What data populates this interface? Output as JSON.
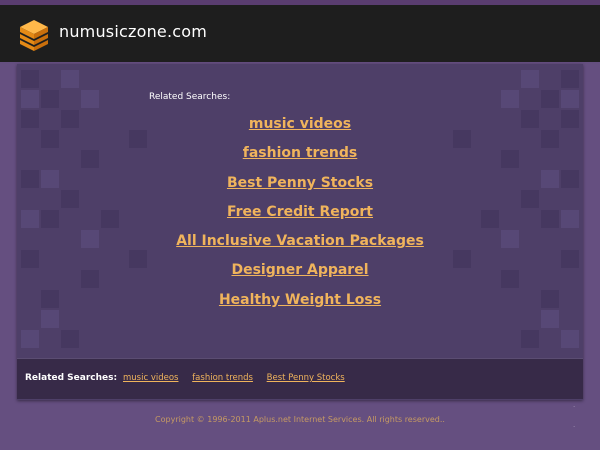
{
  "header": {
    "site_title": "numusiczone.com",
    "logo_icon": "layered-box-logo-icon"
  },
  "main": {
    "related_heading": "Related Searches:",
    "links": [
      "music videos",
      "fashion trends",
      "Best Penny Stocks",
      "Free Credit Report",
      "All Inclusive Vacation Packages",
      "Designer Apparel",
      "Healthy Weight Loss"
    ]
  },
  "bottom_bar": {
    "label": "Related Searches:",
    "links": [
      "music videos",
      "fashion trends",
      "Best Penny Stocks"
    ]
  },
  "footer": {
    "copyright": "Copyright © 1996-2011 Aplus.net Internet Services. All rights reserved.."
  },
  "colors": {
    "page_bg": "#654f80",
    "header_bg": "#1e1e1e",
    "panel_bg": "#4e3f68",
    "link": "#f0b45c",
    "logo_orange": "#f39a1f"
  }
}
